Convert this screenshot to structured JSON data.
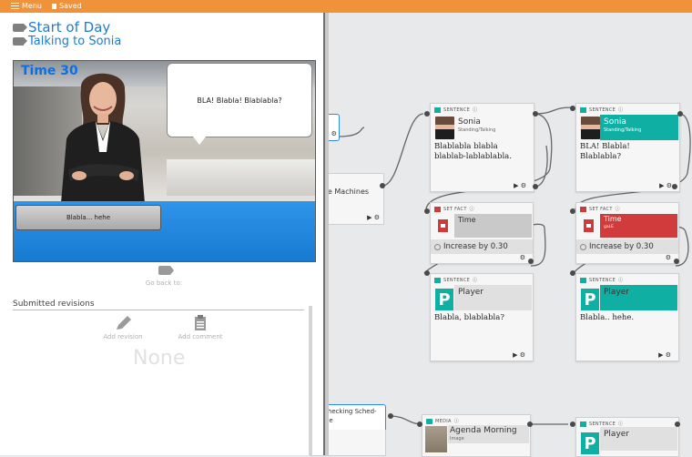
{
  "topbar": {
    "menu_label": "Menu",
    "saved_label": "Saved"
  },
  "panel": {
    "title": "Start of Day",
    "subtitle": "Talking to Sonia",
    "timer": "Time  30",
    "bubble_text": "BLA! Blabla! Blablabla?",
    "choice_text": "Blabla... hehe",
    "go_back_label": "Go back to:",
    "revisions_title": "Submitted revisions",
    "add_revision": "Add revision",
    "add_comment": "Add comment",
    "none_text": "None"
  },
  "canvas": {
    "partial_nodes": {
      "coffee": "ee Machines",
      "checking": "Checking Sched-\nule"
    },
    "nodes": {
      "sentence1": {
        "header": "SENTENCE",
        "name": "Sonia",
        "sub": "Standing/Talking",
        "text": "Blablabla blabla blablab-lablablabla."
      },
      "sentence2": {
        "header": "SENTENCE",
        "name": "Sonia",
        "sub": "Standing/Talking",
        "text": "BLA! Blabla! Blablabla?"
      },
      "fact1": {
        "header": "SET FACT",
        "name": "Time",
        "action": "Increase by 0.30"
      },
      "fact2": {
        "header": "SET FACT",
        "name": "Time",
        "sub": "gaLE",
        "action": "Increase by 0.30"
      },
      "player1": {
        "header": "SENTENCE",
        "name": "Player",
        "letter": "P",
        "text": "Blabla, blablabla?"
      },
      "player2": {
        "header": "SENTENCE",
        "name": "Player",
        "letter": "P",
        "text": "Blabla.. hehe."
      },
      "media": {
        "header": "MEDIA",
        "name": "Agenda Morning",
        "sub": "Image"
      },
      "player3": {
        "header": "SENTENCE",
        "name": "Player",
        "letter": "P"
      }
    }
  }
}
